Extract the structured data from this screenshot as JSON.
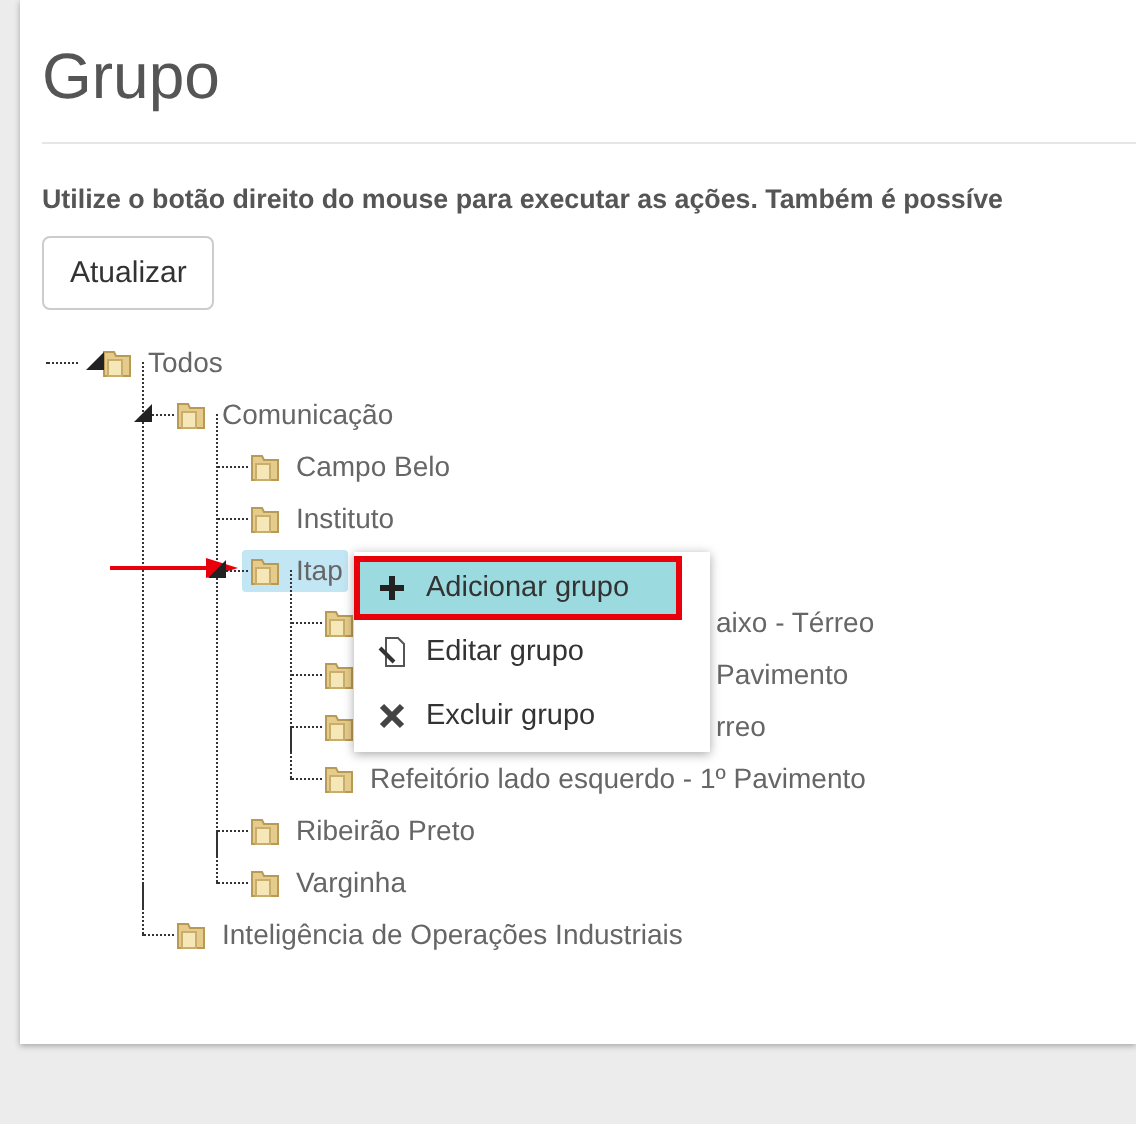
{
  "title": "Grupo",
  "instructions": "Utilize o botão direito do mouse para executar as ações. Também é possíve",
  "refresh_button": "Atualizar",
  "tree": [
    {
      "label": "Todos",
      "expanded": true,
      "selected": false,
      "children": [
        {
          "label": "Comunicação",
          "expanded": true,
          "selected": false,
          "children": [
            {
              "label": "Campo Belo",
              "selected": false
            },
            {
              "label": "Instituto",
              "selected": false
            },
            {
              "label": "Itap",
              "selected": true,
              "arrow": true,
              "expanded": true,
              "children": [
                {
                  "label": "aixo - Térreo",
                  "selected": false,
                  "covered": true
                },
                {
                  "label": "Pavimento",
                  "selected": false,
                  "covered": true
                },
                {
                  "label": "rreo",
                  "selected": false,
                  "covered": true
                },
                {
                  "label": "Refeitório lado esquerdo - 1º Pavimento",
                  "selected": false
                }
              ]
            },
            {
              "label": "Ribeirão Preto",
              "selected": false
            },
            {
              "label": "Varginha",
              "selected": false
            }
          ]
        },
        {
          "label": "Inteligência de Operações Industriais",
          "selected": false
        }
      ]
    }
  ],
  "context_menu": [
    {
      "label": "Adicionar grupo",
      "kind": "add",
      "selected": true,
      "outlined": true
    },
    {
      "label": "Editar grupo",
      "kind": "edit",
      "selected": false,
      "outlined": false
    },
    {
      "label": "Excluir grupo",
      "kind": "delete",
      "selected": false,
      "outlined": false
    }
  ]
}
